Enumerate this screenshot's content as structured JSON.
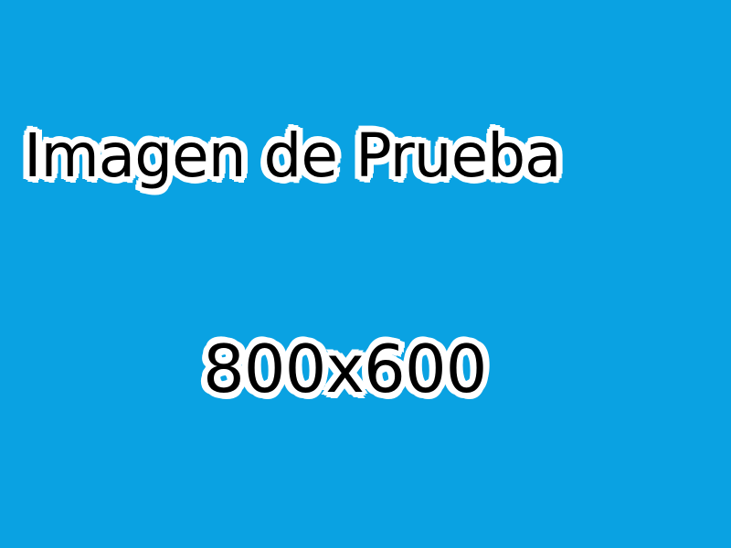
{
  "background_color": "#0aa2e2",
  "text_color": "#000000",
  "outline_color": "#ffffff",
  "title": "Imagen de Prueba",
  "dimensions": "800x600"
}
